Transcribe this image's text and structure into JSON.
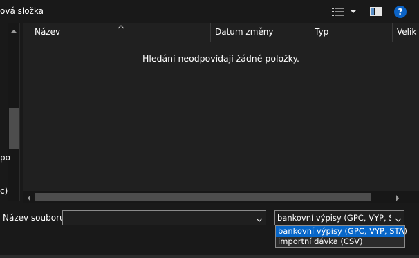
{
  "toolbar": {
    "new_folder_label": "ová složka",
    "view_icon": "details-view-icon",
    "view_dropdown_icon": "chevron-down-icon",
    "pane_icon": "preview-pane-icon",
    "help_label": "?"
  },
  "nav": {
    "partial_label_1": "po",
    "partial_label_2": "c)"
  },
  "file_list": {
    "columns": [
      "Název",
      "Datum změny",
      "Typ",
      "Velik"
    ],
    "empty_message": "Hledání neodpovídají žádné položky."
  },
  "bottom": {
    "filename_label": "Název souboru:",
    "filename_value": "",
    "filetype_selected": "bankovní výpisy (GPC, VYP, STA)",
    "filetype_options": [
      "bankovní výpisy (GPC, VYP, STA)",
      "importní dávka (CSV)"
    ]
  },
  "colors": {
    "background": "#191919",
    "list_background": "#202020",
    "accent": "#0867c9",
    "help_blue": "#0b63c6"
  }
}
